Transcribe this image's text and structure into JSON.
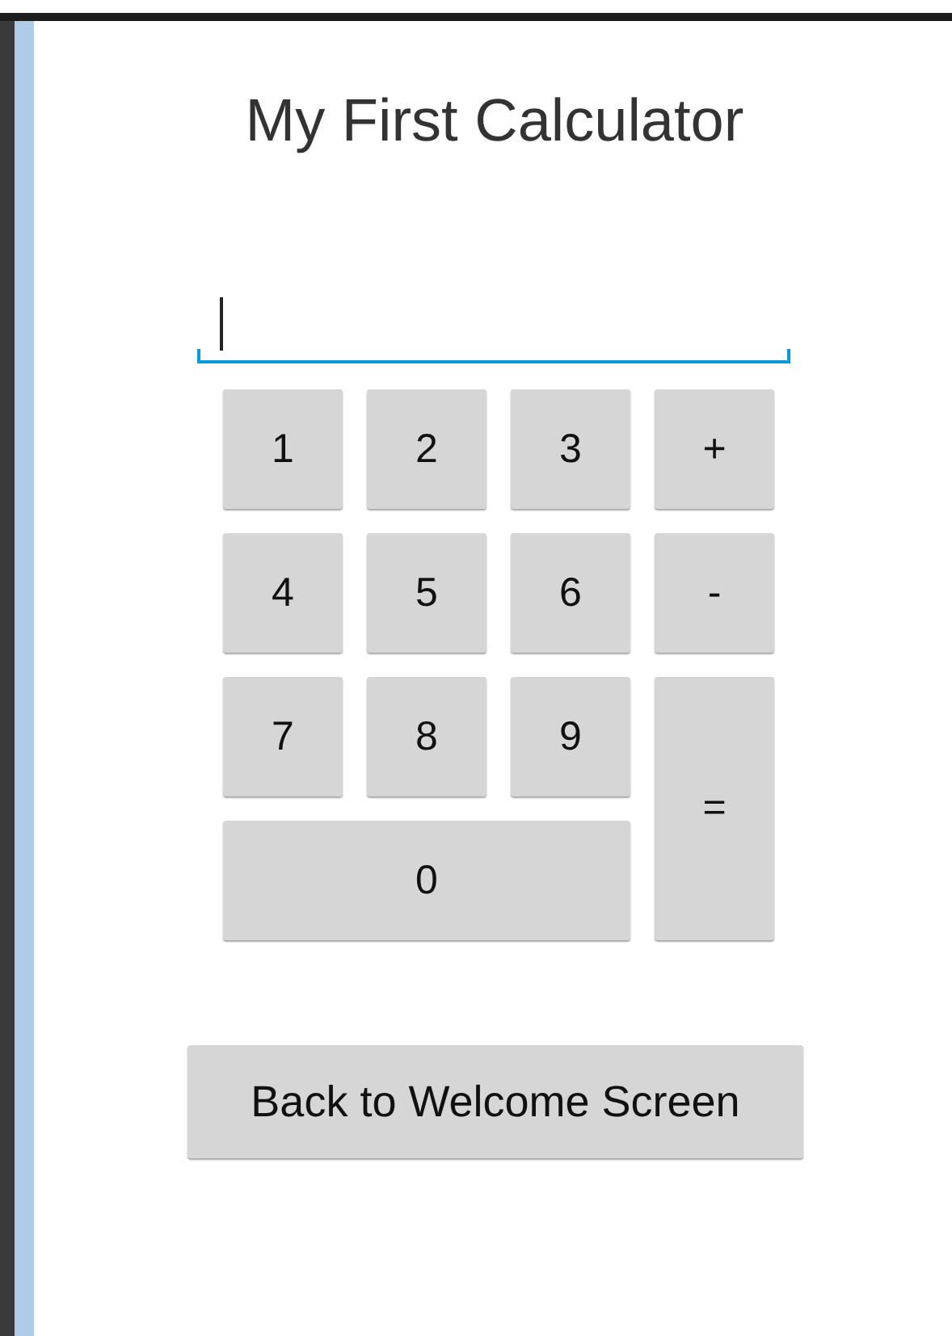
{
  "title": "My First Calculator",
  "keys": [
    {
      "label": "1",
      "kind": "digit"
    },
    {
      "label": "2",
      "kind": "digit"
    },
    {
      "label": "3",
      "kind": "digit"
    },
    {
      "label": "+",
      "kind": "operator"
    },
    {
      "label": "4",
      "kind": "digit"
    },
    {
      "label": "5",
      "kind": "digit"
    },
    {
      "label": "6",
      "kind": "digit"
    },
    {
      "label": "-",
      "kind": "operator"
    },
    {
      "label": "7",
      "kind": "digit"
    },
    {
      "label": "8",
      "kind": "digit"
    },
    {
      "label": "9",
      "kind": "digit"
    },
    {
      "label": "=",
      "kind": "equals"
    },
    {
      "label": "0",
      "kind": "zero"
    }
  ],
  "back_button": "Back to Welcome Screen"
}
